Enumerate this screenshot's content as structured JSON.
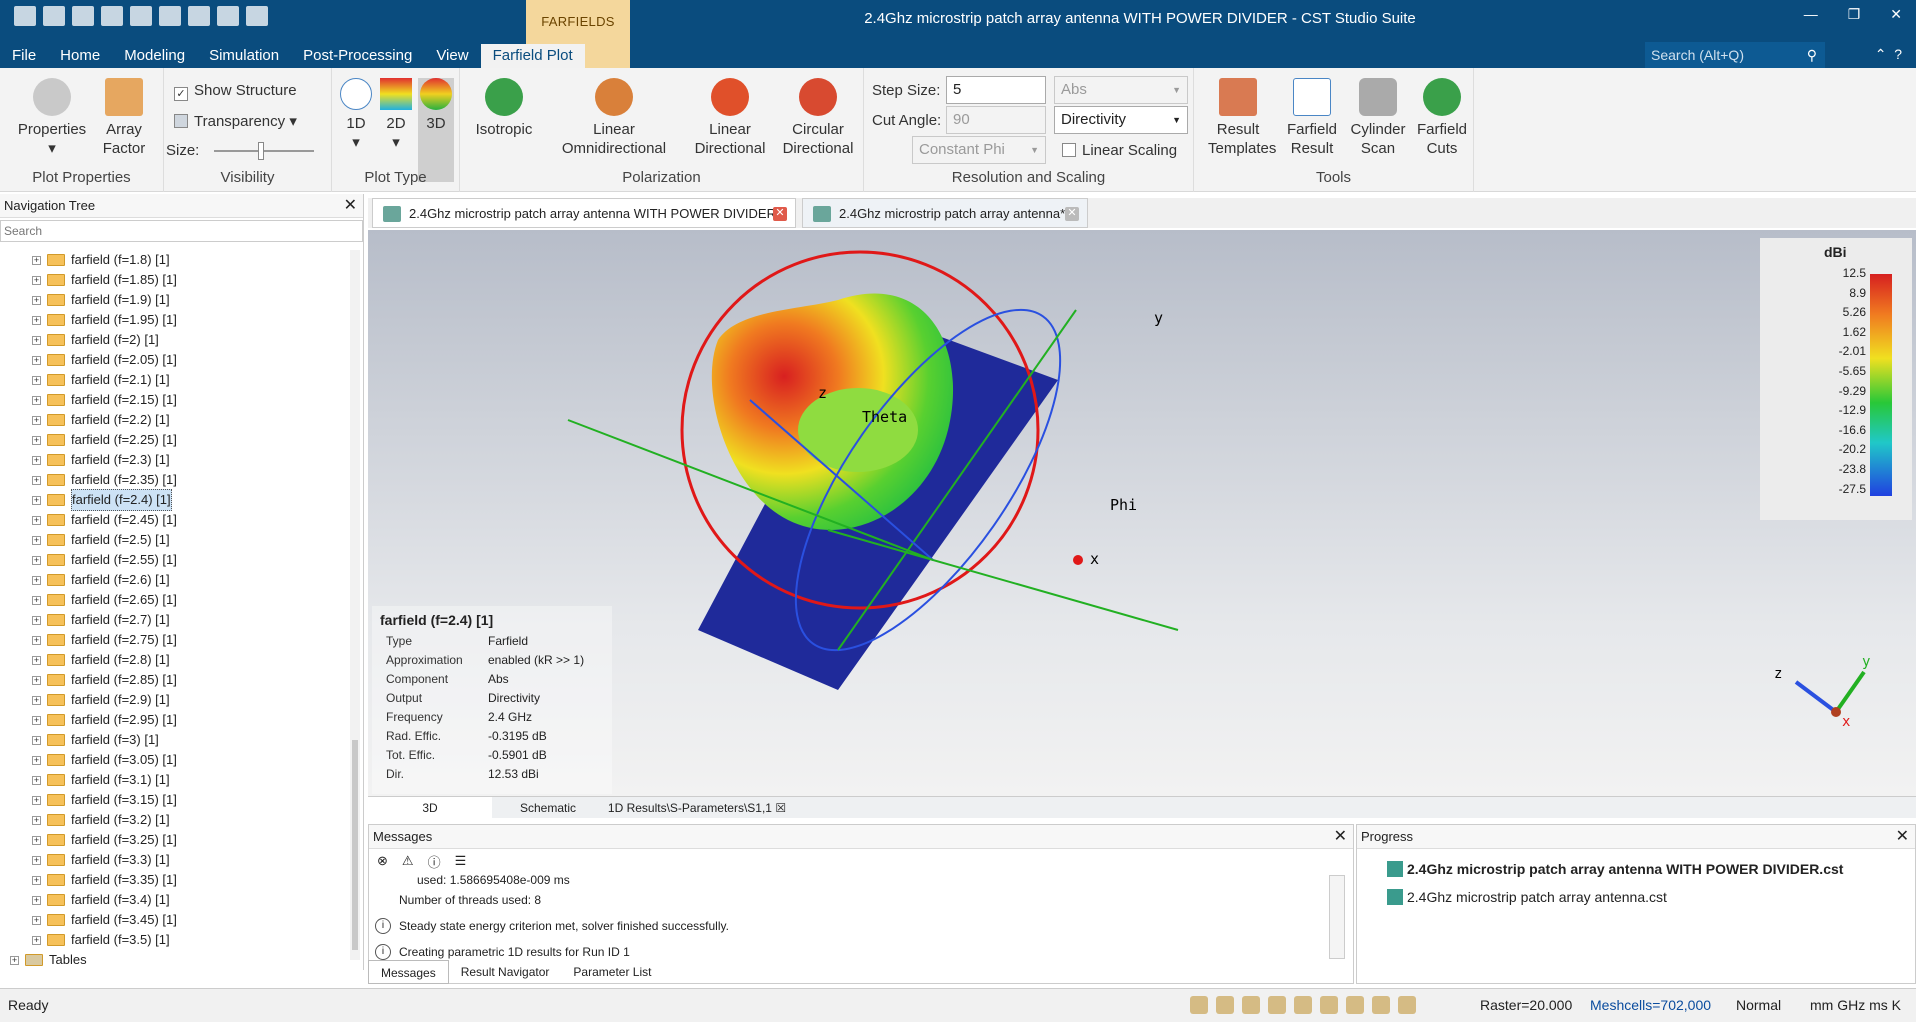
{
  "window": {
    "title": "2.4Ghz microstrip patch array antenna WITH POWER DIVIDER - CST Studio Suite",
    "context_tab": "FARFIELDS",
    "search_placeholder": "Search (Alt+Q)"
  },
  "menu": [
    "File",
    "Home",
    "Modeling",
    "Simulation",
    "Post-Processing",
    "View",
    "Farfield Plot"
  ],
  "ribbon": {
    "plot_properties": {
      "group": "Plot Properties",
      "properties": "Properties",
      "array_factor_1": "Array",
      "array_factor_2": "Factor"
    },
    "visibility": {
      "group": "Visibility",
      "show_structure": "Show Structure",
      "transparency": "Transparency",
      "size": "Size:"
    },
    "plot_type": {
      "group": "Plot Type",
      "b1d": "1D",
      "b2d": "2D",
      "b3d": "3D"
    },
    "polarization": {
      "group": "Polarization",
      "isotropic": "Isotropic",
      "lin_omni_1": "Linear",
      "lin_omni_2": "Omnidirectional",
      "lin_dir_1": "Linear",
      "lin_dir_2": "Directional",
      "circ_1": "Circular",
      "circ_2": "Directional"
    },
    "resolution": {
      "group": "Resolution and Scaling",
      "step_size_label": "Step Size:",
      "step_size": "5",
      "cut_angle_label": "Cut Angle:",
      "cut_angle": "90",
      "constant_phi": "Constant Phi",
      "abs": "Abs",
      "directivity": "Directivity",
      "linear_scaling": "Linear Scaling"
    },
    "tools": {
      "group": "Tools",
      "rt1": "Result",
      "rt2": "Templates",
      "fr1": "Farfield",
      "fr2": "Result",
      "cs1": "Cylinder",
      "cs2": "Scan",
      "fc1": "Farfield",
      "fc2": "Cuts"
    }
  },
  "nav": {
    "title": "Navigation Tree",
    "search": "Search",
    "tables": "Tables",
    "items": [
      "farfield (f=1.8) [1]",
      "farfield (f=1.85) [1]",
      "farfield (f=1.9) [1]",
      "farfield (f=1.95) [1]",
      "farfield (f=2) [1]",
      "farfield (f=2.05) [1]",
      "farfield (f=2.1) [1]",
      "farfield (f=2.15) [1]",
      "farfield (f=2.2) [1]",
      "farfield (f=2.25) [1]",
      "farfield (f=2.3) [1]",
      "farfield (f=2.35) [1]",
      "farfield (f=2.4) [1]",
      "farfield (f=2.45) [1]",
      "farfield (f=2.5) [1]",
      "farfield (f=2.55) [1]",
      "farfield (f=2.6) [1]",
      "farfield (f=2.65) [1]",
      "farfield (f=2.7) [1]",
      "farfield (f=2.75) [1]",
      "farfield (f=2.8) [1]",
      "farfield (f=2.85) [1]",
      "farfield (f=2.9) [1]",
      "farfield (f=2.95) [1]",
      "farfield (f=3) [1]",
      "farfield (f=3.05) [1]",
      "farfield (f=3.1) [1]",
      "farfield (f=3.15) [1]",
      "farfield (f=3.2) [1]",
      "farfield (f=3.25) [1]",
      "farfield (f=3.3) [1]",
      "farfield (f=3.35) [1]",
      "farfield (f=3.4) [1]",
      "farfield (f=3.45) [1]",
      "farfield (f=3.5) [1]"
    ],
    "selected_index": 12
  },
  "doc_tabs": [
    "2.4Ghz microstrip patch array antenna WITH POWER DIVIDER*",
    "2.4Ghz microstrip patch array antenna*"
  ],
  "info": {
    "title": "farfield (f=2.4) [1]",
    "rows": [
      [
        "Type",
        "Farfield"
      ],
      [
        "Approximation",
        "enabled (kR >> 1)"
      ],
      [
        "Component",
        "Abs"
      ],
      [
        "Output",
        "Directivity"
      ],
      [
        "Frequency",
        "2.4 GHz"
      ],
      [
        "Rad. Effic.",
        "-0.3195 dB"
      ],
      [
        "Tot. Effic.",
        "-0.5901 dB"
      ],
      [
        "Dir.",
        "12.53 dBi"
      ]
    ]
  },
  "legend": {
    "unit": "dBi",
    "ticks": [
      "12.5",
      "8.9",
      "5.26",
      "1.62",
      "-2.01",
      "-5.65",
      "-9.29",
      "-12.9",
      "-16.6",
      "-20.2",
      "-23.8",
      "-27.5"
    ]
  },
  "axes": {
    "x": "x",
    "y": "y",
    "z": "z",
    "theta": "Theta",
    "phi": "Phi"
  },
  "view_tabs": [
    "3D",
    "Schematic",
    "1D Results\\S-Parameters\\S1,1"
  ],
  "messages": {
    "title": "Messages",
    "lines": [
      "used: 1.586695408e-009 ms",
      "Number of threads used: 8",
      "Steady state energy criterion met, solver finished successfully.",
      "Creating parametric 1D results for Run ID 1"
    ],
    "tabs": [
      "Messages",
      "Result Navigator",
      "Parameter List"
    ]
  },
  "progress": {
    "title": "Progress",
    "items": [
      "2.4Ghz microstrip patch array antenna WITH POWER DIVIDER.cst",
      "2.4Ghz microstrip patch array antenna.cst"
    ]
  },
  "status": {
    "ready": "Ready",
    "raster": "Raster=20.000",
    "meshcells": "Meshcells=702,000",
    "mode": "Normal",
    "units": "mm  GHz  ms  K"
  }
}
